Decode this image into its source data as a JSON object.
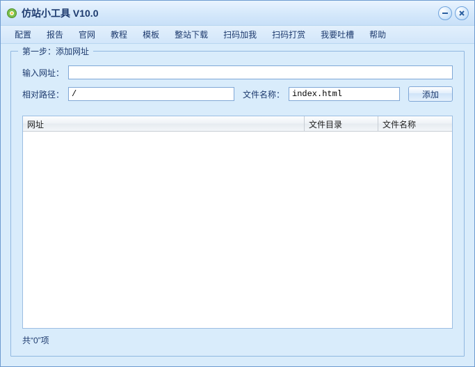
{
  "window": {
    "title": "仿站小工具 V10.0"
  },
  "menubar": {
    "items": [
      "配置",
      "报告",
      "官网",
      "教程",
      "模板",
      "整站下载",
      "扫码加我",
      "扫码打赏",
      "我要吐槽",
      "帮助"
    ]
  },
  "group": {
    "legend": "第一步：添加网址",
    "url_label": "输入网址：",
    "url_value": "",
    "path_label": "相对路径：",
    "path_value": "/",
    "fname_label": "文件名称：",
    "fname_value": "index.html",
    "add_btn": "添加"
  },
  "table": {
    "headers": {
      "url": "网址",
      "dir": "文件目录",
      "fname": "文件名称"
    }
  },
  "footer": {
    "count_text": "共“0”项"
  }
}
